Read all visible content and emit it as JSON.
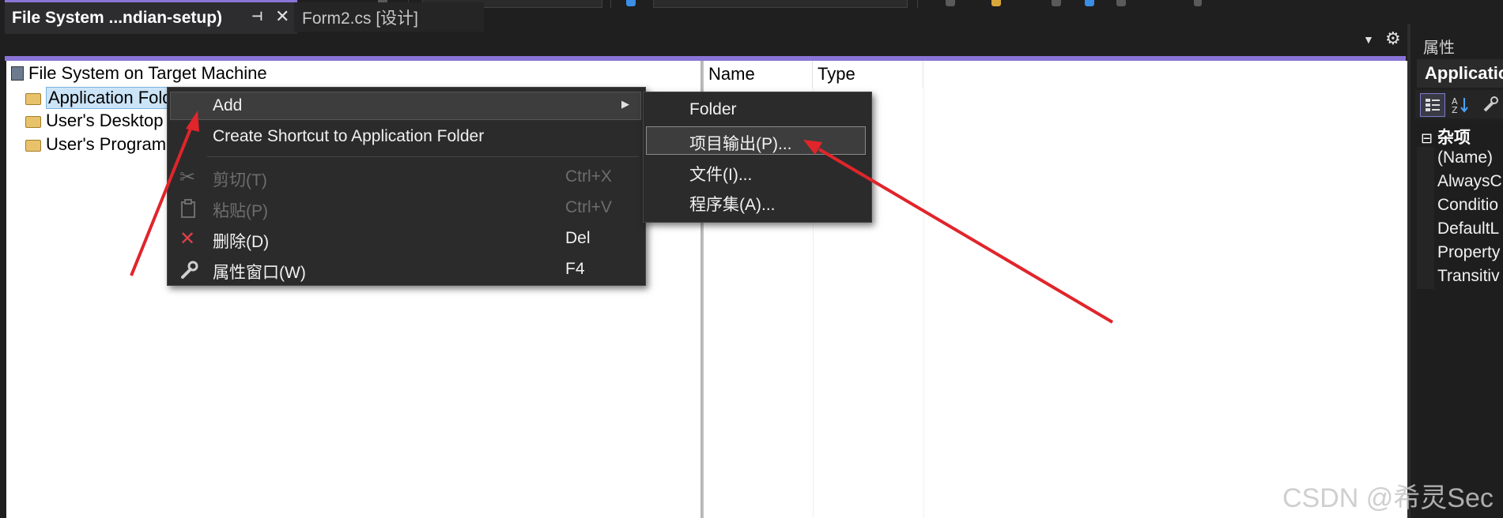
{
  "tabs": [
    {
      "label": "File System ...ndian-setup)",
      "active": true
    },
    {
      "label": "Form2.cs [设计]",
      "active": false
    }
  ],
  "tree": {
    "root": "File System on Target Machine",
    "items": [
      "Application Fold",
      "User's Desktop",
      "User's Programs"
    ]
  },
  "list": {
    "columns": [
      "Name",
      "Type"
    ]
  },
  "context_menu": {
    "items": [
      {
        "label": "Add",
        "shortcut": "",
        "icon": "",
        "submenu": true,
        "enabled": true
      },
      {
        "label": "Create Shortcut to Application Folder",
        "shortcut": "",
        "icon": "",
        "enabled": true
      },
      {
        "label": "剪切(T)",
        "shortcut": "Ctrl+X",
        "icon": "cut-icon",
        "enabled": false
      },
      {
        "label": "粘贴(P)",
        "shortcut": "Ctrl+V",
        "icon": "paste-icon",
        "enabled": false
      },
      {
        "label": "删除(D)",
        "shortcut": "Del",
        "icon": "delete-icon",
        "enabled": true
      },
      {
        "label": "属性窗口(W)",
        "shortcut": "F4",
        "icon": "wrench-icon",
        "enabled": true
      }
    ]
  },
  "submenu": {
    "items": [
      "Folder",
      "项目输出(P)...",
      "文件(I)...",
      "程序集(A)..."
    ]
  },
  "properties": {
    "title": "属性",
    "object_name": "Applicatio",
    "category": "杂项",
    "rows": [
      "(Name)",
      "AlwaysC",
      "Conditio",
      "DefaultL",
      "Property",
      "Transitiv"
    ]
  },
  "watermark": "CSDN @希灵Sec",
  "colors": {
    "accent": "#8a74d6",
    "annotation_arrow": "#e0252b",
    "delete_icon": "#e0404a"
  }
}
